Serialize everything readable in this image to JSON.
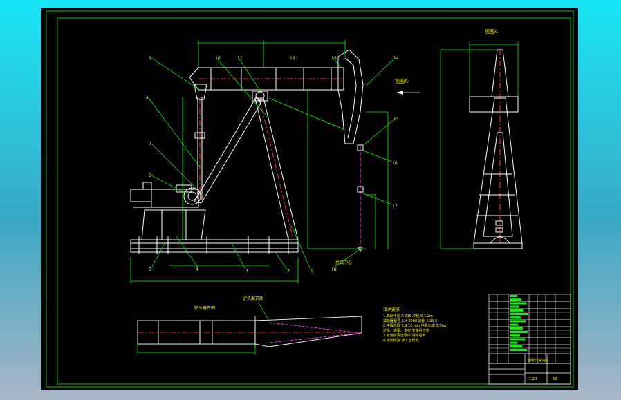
{
  "title": "Pumping unit assembly drawing",
  "view_label": "视图A",
  "arrow_label": "视图A",
  "location_label": "井口中心",
  "section_label": "驴头展开图",
  "notes_title": "技术要求",
  "notes": [
    "1.曲柄半径 R 315 冲程 S 1.2m",
    "  减速器型号 JLH-2000 速比 1:31.6",
    "2.冲程次数 6,9,12 min  电机功率 5.5kw",
    "  驴头、游梁、支架 安装后检查",
    "3.安装前清洗零件 清除毛刺",
    "4.涂防锈漆 按工艺规范"
  ],
  "part_callouts": [
    "1",
    "2",
    "3",
    "4",
    "5",
    "6",
    "7",
    "8",
    "9",
    "10",
    "11",
    "12",
    "13",
    "14",
    "15",
    "16",
    "17",
    "18"
  ],
  "title_block": {
    "name": "游梁式抽油机",
    "scale": "1:20",
    "sheet": "A0"
  },
  "colors": {
    "frame": "#00c800",
    "outline": "#ffffff",
    "dimension": "#00ff00",
    "centerline": "#ff3030",
    "hidden": "#ff40ff",
    "text": "#ffff00",
    "part": "#ffffff",
    "rod": "#ff4040"
  }
}
